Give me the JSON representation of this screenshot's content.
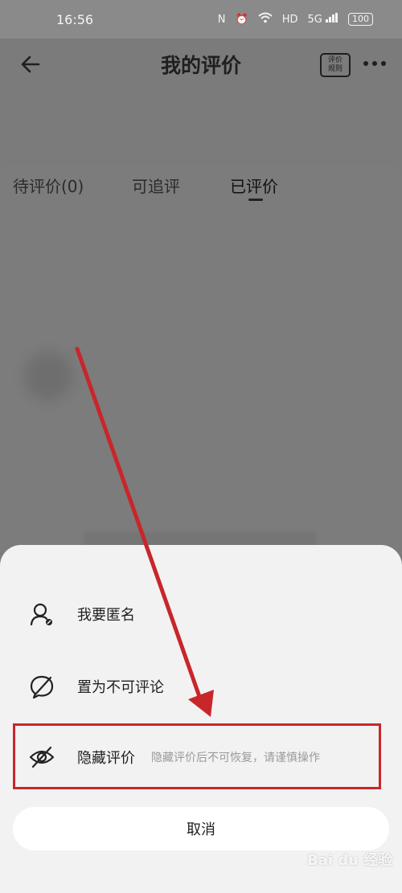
{
  "status_bar": {
    "time": "16:56",
    "nfc": "N",
    "network": "5G",
    "hd": "HD",
    "battery": "100"
  },
  "header": {
    "title": "我的评价",
    "rules_label_line1": "评价",
    "rules_label_line2": "规则"
  },
  "tabs": [
    {
      "label": "待评价(0)"
    },
    {
      "label": "可追评"
    },
    {
      "label": "已评价"
    }
  ],
  "sheet": {
    "items": [
      {
        "label": "我要匿名",
        "icon": "anonymous-user-icon"
      },
      {
        "label": "置为不可评论",
        "icon": "no-comment-icon"
      },
      {
        "label": "隐藏评价",
        "hint": "隐藏评价后不可恢复，请谨慎操作",
        "icon": "eye-hidden-icon"
      }
    ],
    "cancel_label": "取消"
  },
  "watermark": "Bai du 经验",
  "colors": {
    "highlight": "#c8262b",
    "arrow": "#c8262b",
    "sheet_bg": "#f2f2f2"
  }
}
